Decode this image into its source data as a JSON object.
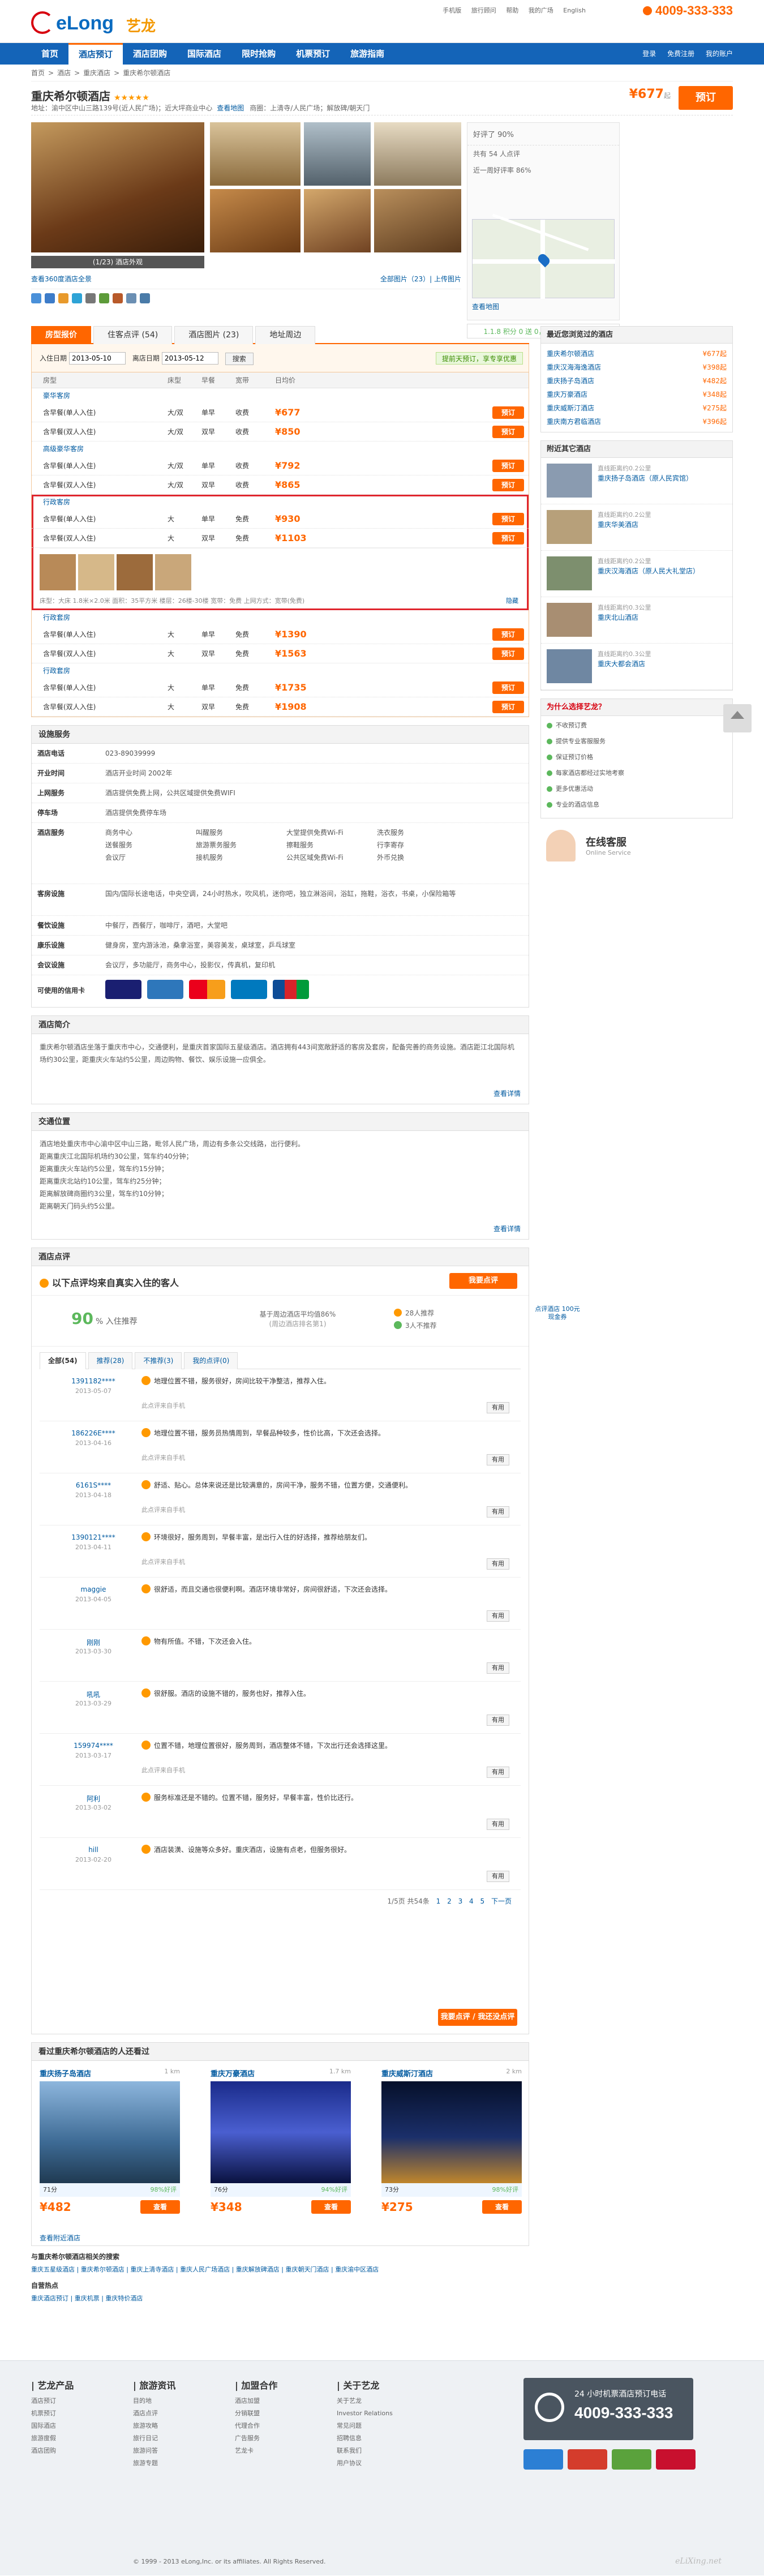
{
  "header": {
    "logo_text": "eLong",
    "logo_cn": "艺龙",
    "top_links": [
      "手机版",
      "旅行顾问",
      "帮助",
      "我的广场",
      "English"
    ],
    "hotline": "4009-333-333"
  },
  "nav": {
    "items": [
      "首页",
      "酒店预订",
      "酒店团购",
      "国际酒店",
      "限时抢购",
      "机票预订",
      "旅游指南"
    ],
    "active_index": 1,
    "right": [
      "登录",
      "免费注册",
      "我的账户"
    ]
  },
  "breadcrumb": [
    "首页",
    ">",
    "酒店",
    ">",
    "重庆酒店",
    ">",
    "重庆希尔顿酒店"
  ],
  "hotel": {
    "name": "重庆希尔顿酒店",
    "stars": "★★★★★",
    "address": "地址：渝中区中山三路139号(近人民广场)；近大坪商业中心",
    "map_link": "查看地图",
    "area": "商圈：上清寺/人民广场；解放碑/朝天门",
    "price": "¥677",
    "price_suffix": "起",
    "book_label": "预订",
    "gallery_caption": "(1/23) 酒店外观",
    "gallery_left": "查看360度酒店全景",
    "gallery_right": "全部图片（23）| 上传图片",
    "score_label": "好评了 90%",
    "score_value": "90",
    "score_sub": "共有 54 人点评",
    "score_rate": "近一周好评率 86%",
    "map_title": "地图",
    "map_footer": "查看地图",
    "vip_line": "1.1.8 积分 0 送 0，10000 万里程可用"
  },
  "booking": {
    "tabs": [
      "房型报价",
      "住客点评 (54)",
      "酒店图片 (23)",
      "地址周边"
    ],
    "checkin_label": "入住日期",
    "checkin_value": "2013-05-10",
    "checkout_label": "离店日期",
    "checkout_value": "2013-05-12",
    "search_label": "搜索",
    "tip": "提前天预订，享专享优惠",
    "headers": [
      "房型",
      "床型",
      "早餐",
      "宽带",
      "日均价"
    ],
    "groups": [
      {
        "title": "豪华客房",
        "rows": [
          {
            "name": "含早餐(单人入住)",
            "bed": "大/双",
            "bf": "单早",
            "net": "收费",
            "price": "¥677"
          },
          {
            "name": "含早餐(双人入住)",
            "bed": "大/双",
            "bf": "双早",
            "net": "收费",
            "price": "¥850"
          }
        ]
      },
      {
        "title": "高级豪华客房",
        "rows": [
          {
            "name": "含早餐(单人入住)",
            "bed": "大/双",
            "bf": "单早",
            "net": "收费",
            "price": "¥792"
          },
          {
            "name": "含早餐(双人入住)",
            "bed": "大/双",
            "bf": "双早",
            "net": "收费",
            "price": "¥865"
          }
        ]
      },
      {
        "title": "行政客房",
        "highlight": true,
        "rows": [
          {
            "name": "含早餐(单人入住)",
            "bed": "大",
            "bf": "单早",
            "net": "免费",
            "price": "¥930"
          },
          {
            "name": "含早餐(双人入住)",
            "bed": "大",
            "bf": "双早",
            "net": "免费",
            "price": "¥1103"
          }
        ]
      },
      {
        "title": "行政套房",
        "rows": [
          {
            "name": "含早餐(单人入住)",
            "bed": "大",
            "bf": "单早",
            "net": "免费",
            "price": "¥1390"
          },
          {
            "name": "含早餐(双人入住)",
            "bed": "大",
            "bf": "双早",
            "net": "免费",
            "price": "¥1563"
          }
        ]
      },
      {
        "title": "行政套房",
        "rows": [
          {
            "name": "含早餐(单人入住)",
            "bed": "大",
            "bf": "单早",
            "net": "免费",
            "price": "¥1735"
          },
          {
            "name": "含早餐(双人入住)",
            "bed": "大",
            "bf": "双早",
            "net": "免费",
            "price": "¥1908"
          }
        ]
      }
    ],
    "book_label": "预订",
    "room_info": "床型：大床 1.8米×2.0米 面积：35平方米 楼层：26楼-30楼 宽带：免费 上网方式：宽带(免费)",
    "hide_label": "隐藏"
  },
  "facilities": {
    "title": "设施服务",
    "rows": [
      {
        "k": "酒店电话",
        "v": "023-89039999"
      },
      {
        "k": "开业时间",
        "v": "酒店开业时间 2002年"
      },
      {
        "k": "上网服务",
        "v": "酒店提供免费上网，公共区域提供免费WIFI"
      },
      {
        "k": "停车场",
        "v": "酒店提供免费停车场"
      }
    ],
    "services_k": "酒店服务",
    "services": [
      "商务中心",
      "叫醒服务",
      "大堂提供免费Wi-Fi",
      "洗衣服务",
      "送餐服务",
      "旅游票务服务",
      "擦鞋服务",
      "行李寄存",
      "会议厅",
      "接机服务",
      "公共区域免费Wi-Fi",
      "外币兑换"
    ],
    "rooms_k": "客房设施",
    "rooms_v": "国内/国际长途电话，中央空调，24小时热水，吹风机，迷你吧，独立淋浴间，浴缸，拖鞋，浴衣，书桌，小保险箱等",
    "dining_k": "餐饮设施",
    "dining_v": "中餐厅，西餐厅，咖啡厅，酒吧，大堂吧",
    "leisure_k": "康乐设施",
    "leisure_v": "健身房，室内游泳池，桑拿浴室，美容美发，桌球室，乒乓球室",
    "meeting_k": "会议设施",
    "meeting_v": "会议厅，多功能厅，商务中心，投影仪，传真机，复印机",
    "cards_k": "可使用的信用卡",
    "cards": [
      "VISA",
      "American Express",
      "MasterCard",
      "DinersClub",
      "JCB"
    ]
  },
  "intro": {
    "title": "酒店简介",
    "text": "重庆希尔顿酒店坐落于重庆市中心，交通便利，是重庆首家国际五星级酒店。酒店拥有443间宽敞舒适的客房及套房，配备完善的商务设施。酒店距江北国际机场约30公里，距重庆火车站约5公里，周边购物、餐饮、娱乐设施一应俱全。",
    "more": "查看详情"
  },
  "traffic": {
    "title": "交通位置",
    "lines": [
      "酒店地处重庆市中心渝中区中山三路，毗邻人民广场，周边有多条公交线路，出行便利。",
      "距离重庆江北国际机场约30公里，驾车约40分钟；",
      "距离重庆火车站约5公里，驾车约15分钟；",
      "距离重庆北站约10公里，驾车约25分钟；",
      "距离解放碑商圈约3公里，驾车约10分钟；",
      "距离朝天门码头约5公里。"
    ],
    "more": "查看详情"
  },
  "reviews": {
    "title": "酒店点评",
    "headline": "以下点评均来自真实入住的客人",
    "write_label": "我要点评",
    "pct_label": "% 入住推荐",
    "pct_value": "90",
    "mid_line1": "基于周边酒店平均值86%",
    "mid_line2": "(周边酒店排名第1)",
    "r1": "28人推荐",
    "r2": "3人不推荐",
    "tabs": [
      "全部(54)",
      "推荐(28)",
      "不推荐(3)",
      "我的点评(0)"
    ],
    "items": [
      {
        "u": "1391182****",
        "d": "2013-05-07",
        "c": "地理位置不错，服务很好，房间比较干净整洁，推荐入住。",
        "m": "此点评来自手机"
      },
      {
        "u": "186226E****",
        "d": "2013-04-16",
        "c": "地理位置不错，服务员热情周到，早餐品种较多，性价比高，下次还会选择。",
        "m": "此点评来自手机"
      },
      {
        "u": "6161S****",
        "d": "2013-04-18",
        "c": "舒适、贴心。总体来说还是比较满意的，房间干净，服务不错，位置方便，交通便利。",
        "m": "此点评来自手机"
      },
      {
        "u": "1390121****",
        "d": "2013-04-11",
        "c": "环境很好，服务周到，早餐丰富，是出行入住的好选择，推荐给朋友们。",
        "m": "此点评来自手机"
      },
      {
        "u": "maggie",
        "d": "2013-04-05",
        "c": "很舒适，而且交通也很便利啊。酒店环境非常好，房间很舒适，下次还会选择。",
        "m": ""
      },
      {
        "u": "刚刚",
        "d": "2013-03-30",
        "c": "物有所值。不错，下次还会入住。",
        "m": ""
      },
      {
        "u": "吼吼",
        "d": "2013-03-29",
        "c": "很舒服。酒店的设施不错的，服务也好，推荐入住。",
        "m": ""
      },
      {
        "u": "159974****",
        "d": "2013-03-17",
        "c": "位置不错，地理位置很好，服务周到，酒店整体不错，下次出行还会选择这里。",
        "m": "此点评来自手机"
      },
      {
        "u": "阿利",
        "d": "2013-03-02",
        "c": "服务标准还是不错的。位置不错，服务好，早餐丰富，性价比还行。",
        "m": ""
      },
      {
        "u": "hill",
        "d": "2013-02-20",
        "c": "酒店装潢、设施等众多好。重庆酒店，设施有点老，但服务很好。",
        "m": ""
      }
    ],
    "useful": "有用",
    "pager": "1/5页 共54条",
    "pages": [
      "1",
      "2",
      "3",
      "4",
      "5",
      "下一页"
    ],
    "write_bottom": "我要点评 / 我还没点评"
  },
  "also": {
    "title": "看过重庆希尔顿酒店的人还看过",
    "hotels": [
      {
        "n": "重庆扬子岛酒店",
        "dist": "1 km",
        "stat1": "71分",
        "stat2": "98%好评",
        "price": "¥482",
        "btn": "查看"
      },
      {
        "n": "重庆万豪酒店",
        "dist": "1.7 km",
        "stat1": "76分",
        "stat2": "94%好评",
        "price": "¥348",
        "btn": "查看"
      },
      {
        "n": "重庆威斯汀酒店",
        "dist": "2 km",
        "stat1": "73分",
        "stat2": "98%好评",
        "price": "¥275",
        "btn": "查看"
      }
    ],
    "more": "查看附近酒店"
  },
  "links": {
    "t1": "与重庆希尔顿酒店相关的搜索",
    "l1": "重庆五星级酒店 | 重庆希尔顿酒店 | 重庆上清寺酒店 | 重庆人民广场酒店 | 重庆解放碑酒店 | 重庆朝天门酒店 | 重庆渝中区酒店",
    "t2": "自营热点",
    "l2": "重庆酒店预订 | 重庆机票 | 重庆特价酒店"
  },
  "right": {
    "history_title": "最近您浏览过的酒店",
    "history": [
      {
        "n": "重庆希尔顿酒店",
        "p": "¥677起"
      },
      {
        "n": "重庆汉海海逸酒店",
        "p": "¥398起"
      },
      {
        "n": "重庆扬子岛酒店",
        "p": "¥482起"
      },
      {
        "n": "重庆万豪酒店",
        "p": "¥348起"
      },
      {
        "n": "重庆威斯汀酒店",
        "p": "¥275起"
      },
      {
        "n": "重庆南方君临酒店",
        "p": "¥396起"
      }
    ],
    "near_title": "附近其它酒店",
    "near": [
      {
        "l": "直线距离约0.2公里",
        "n": "重庆扬子岛酒店（原人民宾馆）"
      },
      {
        "l": "直线距离约0.2公里",
        "n": "重庆华美酒店"
      },
      {
        "l": "直线距离约0.2公里",
        "n": "重庆汉海酒店（原人民大礼堂店）"
      },
      {
        "l": "直线距离约0.3公里",
        "n": "重庆北山酒店"
      },
      {
        "l": "直线距离约0.3公里",
        "n": "重庆大都会酒店"
      }
    ],
    "why_title": "为什么选择艺龙？",
    "why": [
      "不收预订费",
      "提供专业客服服务",
      "保证预订价格",
      "每家酒店都经过实地考察",
      "更多优惠活动",
      "专业的酒店信息"
    ],
    "service_t1": "在线客服",
    "service_t2": "Online Service",
    "bubble": "点评酒店 100元现金券"
  },
  "footer": {
    "cols": [
      {
        "h": "| 艺龙产品",
        "items": [
          "酒店预订",
          "机票预订",
          "国际酒店",
          "旅游度假",
          "酒店团购"
        ]
      },
      {
        "h": "| 旅游资讯",
        "items": [
          "目的地",
          "酒店点评",
          "旅游攻略",
          "旅行日记",
          "旅游问答",
          "旅游专题"
        ]
      },
      {
        "h": "| 加盟合作",
        "items": [
          "酒店加盟",
          "分销联盟",
          "代理合作",
          "广告服务",
          "艺龙卡"
        ]
      },
      {
        "h": "| 关于艺龙",
        "items": [
          "关于艺龙",
          "Investor Relations",
          "常见问题",
          "招聘信息",
          "联系我们",
          "用户协议"
        ]
      }
    ],
    "hot_t1": "24 小时机票酒店预订电话",
    "hot_t2": "4009-333-333",
    "copy": "© 1999 - 2013 eLong,Inc. or its affiliates. All Rights Reserved.",
    "watermark": "eLiXing.net"
  }
}
